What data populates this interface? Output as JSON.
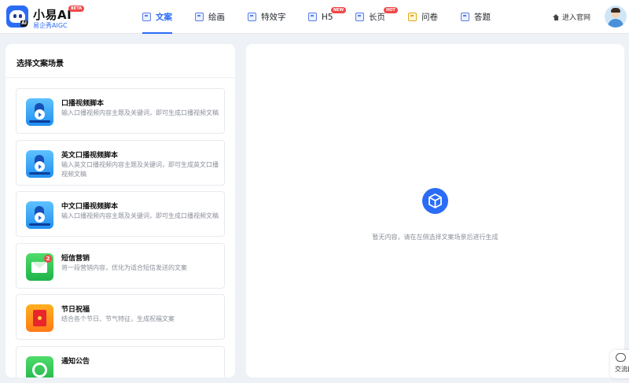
{
  "brand": {
    "name": "小易AI",
    "beta": "BETA",
    "subtitle": "易企秀AIGC",
    "logo_tag": "AI"
  },
  "nav": [
    {
      "label": "文案",
      "icon": "document-icon",
      "active": true
    },
    {
      "label": "绘画",
      "icon": "painting-icon",
      "active": false
    },
    {
      "label": "特效字",
      "icon": "effect-text-icon",
      "active": false
    },
    {
      "label": "H5",
      "icon": "h5-icon",
      "active": false,
      "tag": "NEW"
    },
    {
      "label": "长页",
      "icon": "long-page-icon",
      "active": false,
      "tag": "HOT"
    },
    {
      "label": "问卷",
      "icon": "survey-icon",
      "active": false
    },
    {
      "label": "答题",
      "icon": "quiz-icon",
      "active": false
    }
  ],
  "header_right": {
    "enter_site": "进入官网"
  },
  "left_panel": {
    "title": "选择文案场景",
    "cards": [
      {
        "title": "口播视频脚本",
        "desc": "输入口播视频内容主题及关键词，即可生成口播视频文稿",
        "icon": "video-script-icon"
      },
      {
        "title": "英文口播视频脚本",
        "desc": "输入英文口播视频内容主题及关键词，即可生成英文口播视频文稿",
        "icon": "video-script-icon"
      },
      {
        "title": "中文口播视频脚本",
        "desc": "输入口播视频内容主题及关键词，即可生成口播视频文稿",
        "icon": "video-script-icon"
      },
      {
        "title": "短信营销",
        "desc": "将一段营销内容，优化为适合短信发送的文案",
        "icon": "sms-icon",
        "badge": "2"
      },
      {
        "title": "节日祝福",
        "desc": "结合各个节日、节气特征，生成祝福文案",
        "icon": "red-envelope-icon"
      },
      {
        "title": "通知公告",
        "desc": "",
        "icon": "notice-icon"
      }
    ]
  },
  "right_panel": {
    "empty_text": "暂无内容，请在左侧选择文案场景后进行生成"
  },
  "float": {
    "chat_label": "交流群"
  },
  "colors": {
    "accent": "#2b6cf6",
    "hot": "#f04848"
  }
}
